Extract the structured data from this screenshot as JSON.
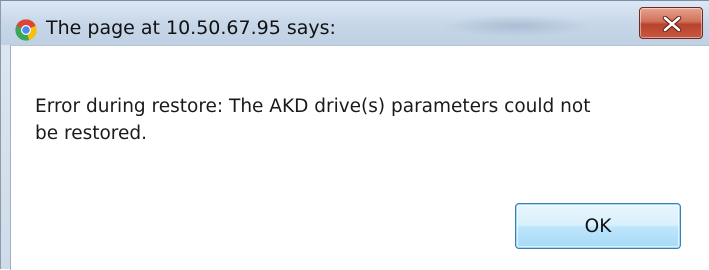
{
  "window": {
    "title": "The page at 10.50.67.95 says:",
    "app_icon": "chrome-logo-icon",
    "close_icon": "close-icon",
    "close_button_color": "#c9583f"
  },
  "dialog": {
    "message_line1": "Error during restore: The AKD drive(s) parameters could not",
    "message_line2": "be restored.",
    "ok_label": "OK",
    "ok_button_color": "#bee6fd"
  }
}
